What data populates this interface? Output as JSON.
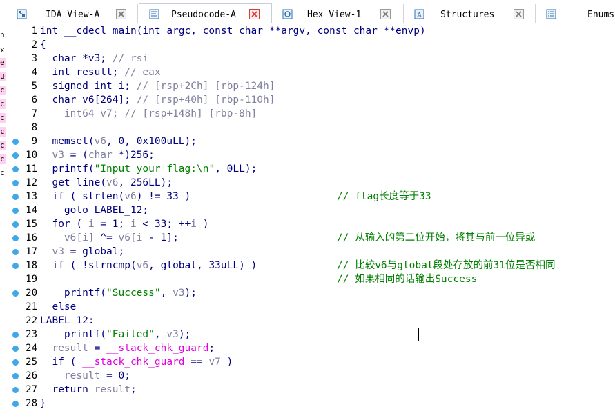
{
  "tabs": [
    {
      "label": "IDA View-A",
      "icon": "graph-view-icon",
      "active": false
    },
    {
      "label": "Pseudocode-A",
      "icon": "pseudocode-icon",
      "active": true
    },
    {
      "label": "Hex View-1",
      "icon": "hex-view-icon",
      "active": false
    },
    {
      "label": "Structures",
      "icon": "structures-icon",
      "active": false
    },
    {
      "label": "Enums",
      "icon": "enums-icon",
      "active": false
    }
  ],
  "left_strip": [
    "n",
    "x",
    "e",
    "u",
    "c",
    "c",
    "c",
    "c",
    "c",
    "c",
    "c"
  ],
  "colors": {
    "keyword": "#000080",
    "variable": "#8080a0",
    "global": "#e000e0",
    "string": "#008000",
    "comment": "#008000",
    "breakpoint_dot": "#40a8e8",
    "active_tab_close": "#d04040"
  },
  "code": [
    {
      "n": "1",
      "dot": false,
      "segs": [
        [
          "t",
          "int __cdecl main(int argc, const char **argv, const char **envp)"
        ]
      ],
      "comment": ""
    },
    {
      "n": "2",
      "dot": false,
      "segs": [
        [
          "t",
          "{"
        ]
      ],
      "comment": ""
    },
    {
      "n": "3",
      "dot": false,
      "segs": [
        [
          "t",
          "  char *v3; "
        ],
        [
          "c",
          "// rsi"
        ]
      ],
      "comment": ""
    },
    {
      "n": "4",
      "dot": false,
      "segs": [
        [
          "t",
          "  int result; "
        ],
        [
          "c",
          "// eax"
        ]
      ],
      "comment": ""
    },
    {
      "n": "5",
      "dot": false,
      "segs": [
        [
          "t",
          "  signed int i; "
        ],
        [
          "c",
          "// [rsp+2Ch] [rbp-124h]"
        ]
      ],
      "comment": ""
    },
    {
      "n": "6",
      "dot": false,
      "segs": [
        [
          "t",
          "  char v6[264]; "
        ],
        [
          "c",
          "// [rsp+40h] [rbp-110h]"
        ]
      ],
      "comment": ""
    },
    {
      "n": "7",
      "dot": false,
      "segs": [
        [
          "v",
          "  __int64 v7; "
        ],
        [
          "c",
          "// [rsp+148h] [rbp-8h]"
        ]
      ],
      "comment": ""
    },
    {
      "n": "8",
      "dot": false,
      "segs": [],
      "comment": ""
    },
    {
      "n": "9",
      "dot": true,
      "segs": [
        [
          "t",
          "  memset("
        ],
        [
          "v",
          "v6"
        ],
        [
          "t",
          ", 0, 0x100uLL);"
        ]
      ],
      "comment": ""
    },
    {
      "n": "10",
      "dot": true,
      "segs": [
        [
          "v",
          "  v3"
        ],
        [
          "t",
          " = ("
        ],
        [
          "v",
          "char"
        ],
        [
          "t",
          " *)256;"
        ]
      ],
      "comment": ""
    },
    {
      "n": "11",
      "dot": true,
      "segs": [
        [
          "t",
          "  printf("
        ],
        [
          "s",
          "\"Input your flag:\\n\""
        ],
        [
          "t",
          ", 0LL);"
        ]
      ],
      "comment": ""
    },
    {
      "n": "12",
      "dot": true,
      "segs": [
        [
          "t",
          "  get_line("
        ],
        [
          "v",
          "v6"
        ],
        [
          "t",
          ", 256LL);"
        ]
      ],
      "comment": ""
    },
    {
      "n": "13",
      "dot": true,
      "segs": [
        [
          "t",
          "  if ( strlen("
        ],
        [
          "v",
          "v6"
        ],
        [
          "t",
          ") != 33 )"
        ]
      ],
      "comment": "// flag长度等于33"
    },
    {
      "n": "14",
      "dot": true,
      "segs": [
        [
          "t",
          "    goto LABEL_12;"
        ]
      ],
      "comment": ""
    },
    {
      "n": "15",
      "dot": true,
      "segs": [
        [
          "t",
          "  for ( "
        ],
        [
          "v",
          "i"
        ],
        [
          "t",
          " = 1; "
        ],
        [
          "v",
          "i"
        ],
        [
          "t",
          " < 33; ++"
        ],
        [
          "v",
          "i"
        ],
        [
          "t",
          " )"
        ]
      ],
      "comment": ""
    },
    {
      "n": "16",
      "dot": true,
      "segs": [
        [
          "v",
          "    v6[i]"
        ],
        [
          "t",
          " ^= "
        ],
        [
          "v",
          "v6[i"
        ],
        [
          "t",
          " - 1];"
        ]
      ],
      "comment": "// 从输入的第二位开始，将其与前一位异或"
    },
    {
      "n": "17",
      "dot": true,
      "segs": [
        [
          "v",
          "  v3"
        ],
        [
          "t",
          " = global;"
        ]
      ],
      "comment": ""
    },
    {
      "n": "18",
      "dot": true,
      "segs": [
        [
          "t",
          "  if ( !strncmp("
        ],
        [
          "v",
          "v6"
        ],
        [
          "t",
          ", global, 33uLL) )"
        ]
      ],
      "comment": "// 比较v6与global段处存放的前31位是否相同"
    },
    {
      "n": "19",
      "dot": false,
      "segs": [],
      "comment": "// 如果相同的话输出Success"
    },
    {
      "n": "20",
      "dot": true,
      "segs": [
        [
          "t",
          "    printf("
        ],
        [
          "s",
          "\"Success\""
        ],
        [
          "t",
          ", "
        ],
        [
          "v",
          "v3"
        ],
        [
          "t",
          ");"
        ]
      ],
      "comment": ""
    },
    {
      "n": "21",
      "dot": false,
      "segs": [
        [
          "t",
          "  else"
        ]
      ],
      "comment": ""
    },
    {
      "n": "22",
      "dot": false,
      "segs": [
        [
          "t",
          "LABEL_12:"
        ]
      ],
      "comment": ""
    },
    {
      "n": "23",
      "dot": true,
      "segs": [
        [
          "t",
          "    printf("
        ],
        [
          "s",
          "\"Failed\""
        ],
        [
          "t",
          ", "
        ],
        [
          "v",
          "v3"
        ],
        [
          "t",
          ");"
        ]
      ],
      "comment": ""
    },
    {
      "n": "24",
      "dot": true,
      "segs": [
        [
          "v",
          "  result"
        ],
        [
          "t",
          " = "
        ],
        [
          "g",
          "__stack_chk_guard"
        ],
        [
          "t",
          ";"
        ]
      ],
      "comment": ""
    },
    {
      "n": "25",
      "dot": true,
      "segs": [
        [
          "t",
          "  if ( "
        ],
        [
          "g",
          "__stack_chk_guard"
        ],
        [
          "t",
          " == "
        ],
        [
          "v",
          "v7"
        ],
        [
          "t",
          " )"
        ]
      ],
      "comment": ""
    },
    {
      "n": "26",
      "dot": true,
      "segs": [
        [
          "v",
          "    result"
        ],
        [
          "t",
          " = 0;"
        ]
      ],
      "comment": ""
    },
    {
      "n": "27",
      "dot": true,
      "segs": [
        [
          "t",
          "  return "
        ],
        [
          "v",
          "result"
        ],
        [
          "t",
          ";"
        ]
      ],
      "comment": ""
    },
    {
      "n": "28",
      "dot": true,
      "segs": [
        [
          "t",
          "}"
        ]
      ],
      "comment": ""
    }
  ]
}
